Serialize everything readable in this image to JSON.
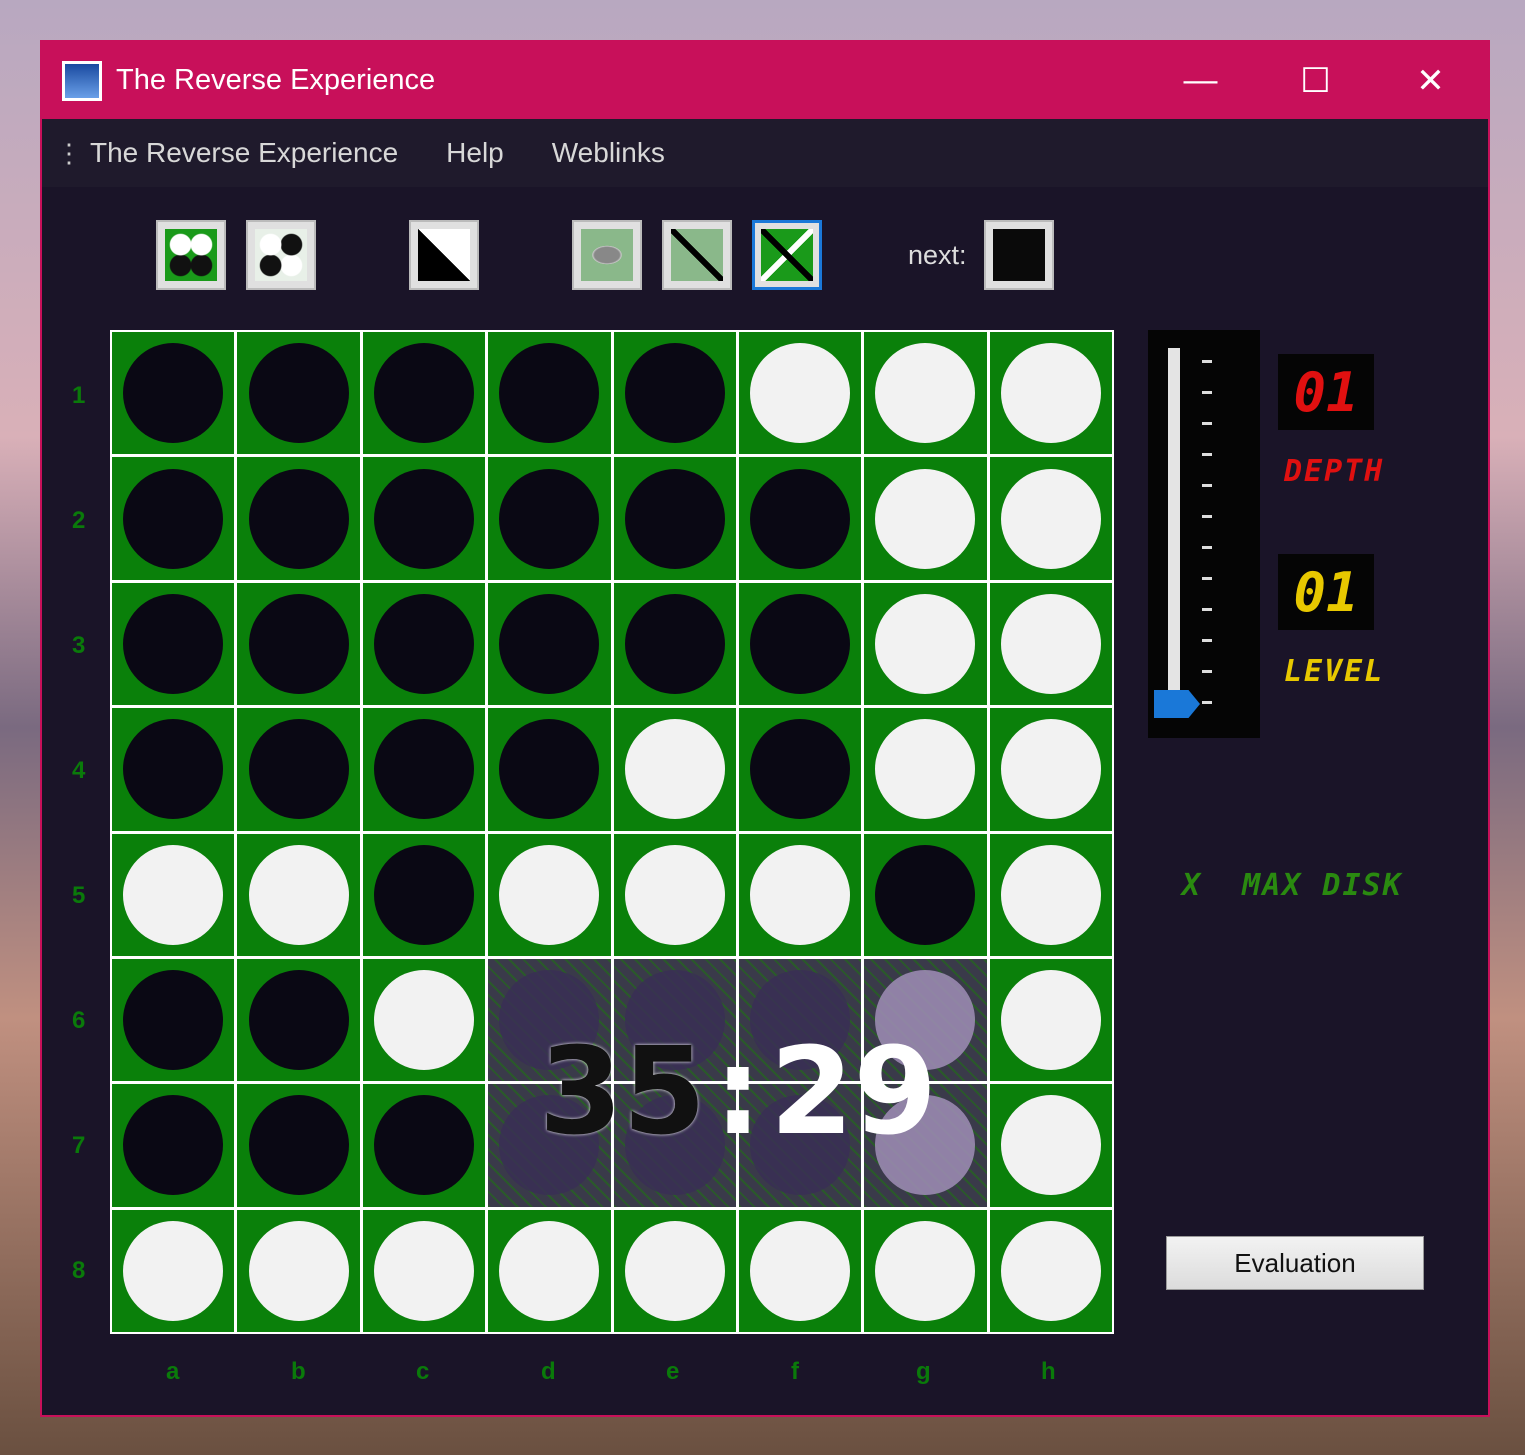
{
  "window": {
    "title": "The Reverse Experience",
    "minimize": "—",
    "maximize": "☐",
    "close": "✕"
  },
  "menu": {
    "items": [
      "The Reverse Experience",
      "Help",
      "Weblinks"
    ]
  },
  "toolbar": {
    "next_label": "next:",
    "next_color": "black"
  },
  "board": {
    "rows": [
      "1",
      "2",
      "3",
      "4",
      "5",
      "6",
      "7",
      "8"
    ],
    "cols": [
      "a",
      "b",
      "c",
      "d",
      "e",
      "f",
      "g",
      "h"
    ],
    "cells": [
      "BBBBBWWW",
      "BBBBBBWW",
      "BBBBBBWW",
      "BBBBWBWW",
      "WWBWWWBW",
      "BBWBBBWW",
      "BBBBBBWW",
      "WWWWWWWW"
    ],
    "score": {
      "black": "35",
      "sep": ":",
      "white": "29"
    }
  },
  "side": {
    "depth_value": "01",
    "depth_label": "DEPTH",
    "level_value": "01",
    "level_label": "LEVEL",
    "max_disk_label": "X  MAX DISK",
    "slider_level": 1,
    "slider_max": 12,
    "evaluation_label": "Evaluation"
  },
  "colors": {
    "titlebar": "#c8105a",
    "board": "#0a800a",
    "depth": "#e01010",
    "level": "#e8c800",
    "maxdisk": "#2a8a10",
    "thumb": "#1a78d8"
  }
}
